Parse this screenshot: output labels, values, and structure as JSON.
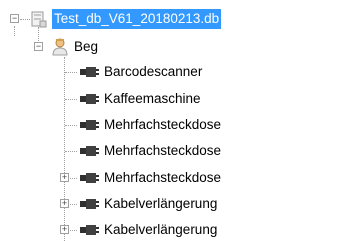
{
  "colors": {
    "selection_bg": "#3399ff",
    "selection_fg": "#ffffff",
    "tree_lines": "#a0a0a0"
  },
  "tree": {
    "root": {
      "label": "Test_db_V61_20180213.db",
      "icon": "database-icon",
      "expanded": true,
      "selected": true
    },
    "group": {
      "label": "Beg",
      "icon": "user-icon",
      "expanded": true
    },
    "items": [
      {
        "label": "Barcodescanner",
        "icon": "plug-icon",
        "has_children": false
      },
      {
        "label": "Kaffeemaschine",
        "icon": "plug-icon",
        "has_children": false
      },
      {
        "label": "Mehrfachsteckdose",
        "icon": "plug-icon",
        "has_children": false
      },
      {
        "label": "Mehrfachsteckdose",
        "icon": "plug-icon",
        "has_children": false
      },
      {
        "label": "Mehrfachsteckdose",
        "icon": "plug-icon",
        "has_children": true
      },
      {
        "label": "Kabelverlängerung",
        "icon": "plug-icon",
        "has_children": true
      },
      {
        "label": "Kabelverlängerung",
        "icon": "plug-icon",
        "has_children": true
      }
    ]
  }
}
